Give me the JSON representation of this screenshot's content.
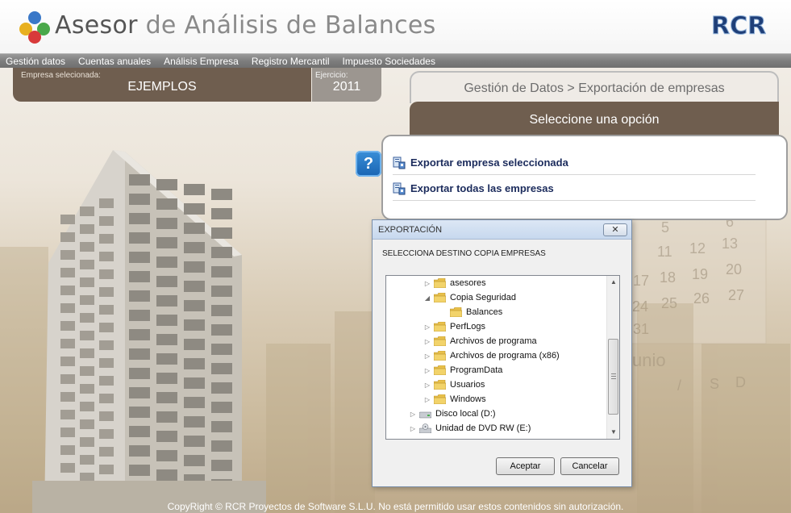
{
  "app": {
    "title_part1": "Asesor",
    "title_part2": "de Análisis de Balances",
    "brand_logo_text": "RCR"
  },
  "menu": {
    "items": [
      "Gestión datos",
      "Cuentas anuales",
      "Análisis Empresa",
      "Registro Mercantil",
      "Impuesto Sociedades"
    ]
  },
  "company": {
    "label": "Empresa selecionada:",
    "value": "EJEMPLOS"
  },
  "year": {
    "label": "Ejercicio:",
    "value": "2011"
  },
  "breadcrumb": "Gestión de Datos > Exportación de empresas",
  "options": {
    "header": "Seleccione una opción",
    "items": [
      {
        "label": "Exportar empresa seleccionada",
        "icon": "export-icon"
      },
      {
        "label": "Exportar todas las empresas",
        "icon": "export-icon"
      }
    ]
  },
  "help": {
    "label": "?",
    "icon": "help-icon"
  },
  "dialog": {
    "title": "EXPORTACIÓN",
    "close_label": "✕",
    "subtitle": "SELECCIONA DESTINO COPIA EMPRESAS",
    "tree": [
      {
        "label": "asesores",
        "arrow": "▷",
        "icon": "folder-icon"
      },
      {
        "label": "Copia Seguridad",
        "arrow": "◢",
        "icon": "folder-icon"
      },
      {
        "label": "Balances",
        "arrow": "",
        "icon": "folder-icon"
      },
      {
        "label": "PerfLogs",
        "arrow": "▷",
        "icon": "folder-icon"
      },
      {
        "label": "Archivos de programa",
        "arrow": "▷",
        "icon": "folder-icon"
      },
      {
        "label": "Archivos de programa (x86)",
        "arrow": "▷",
        "icon": "folder-icon"
      },
      {
        "label": "ProgramData",
        "arrow": "▷",
        "icon": "folder-icon"
      },
      {
        "label": "Usuarios",
        "arrow": "▷",
        "icon": "folder-icon"
      },
      {
        "label": "Windows",
        "arrow": "▷",
        "icon": "folder-icon"
      },
      {
        "label": "Disco local (D:)",
        "arrow": "▷",
        "icon": "drive-icon"
      },
      {
        "label": "Unidad de DVD RW (E:)",
        "arrow": "▷",
        "icon": "dvd-drive-icon"
      }
    ],
    "accept_label": "Aceptar",
    "cancel_label": "Cancelar"
  },
  "footer": "CopyRight © RCR Proyectos de Software S.L.U. No está permitido usar estos contenidos sin autorización.",
  "colors": {
    "brown": "#6f5e4f",
    "navy_text": "#1b2b5c",
    "menu_gray": "#7e7e7e",
    "folder_yellow": "#e8c04a"
  }
}
